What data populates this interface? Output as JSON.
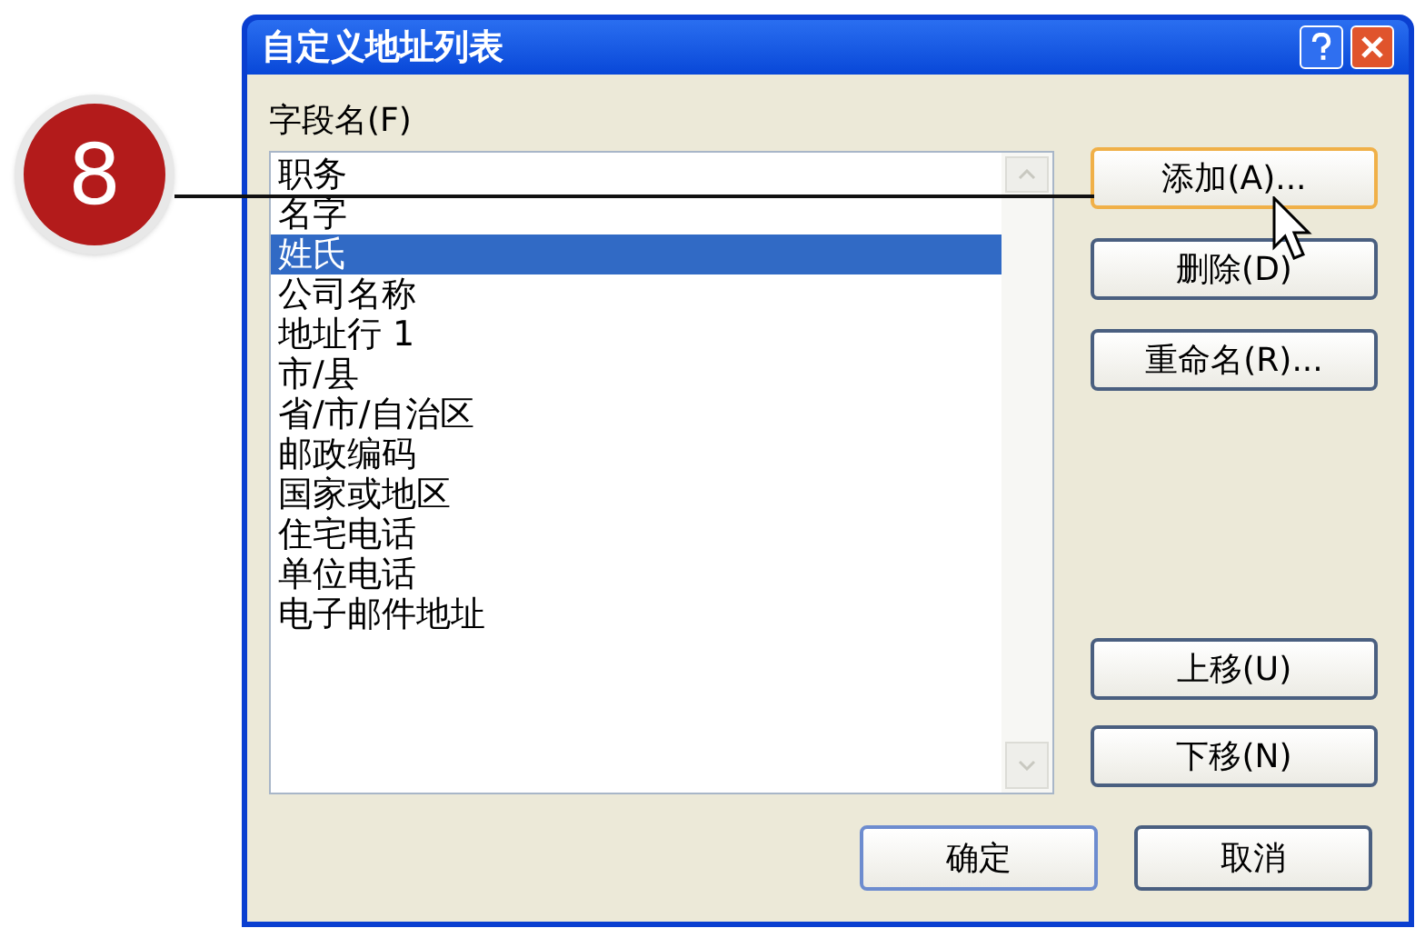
{
  "callout": {
    "number": "8"
  },
  "window": {
    "title": "自定义地址列表"
  },
  "field_list": {
    "label": "字段名(F)",
    "items": [
      {
        "label": "职务",
        "selected": false
      },
      {
        "label": "名字",
        "selected": false
      },
      {
        "label": "姓氏",
        "selected": true
      },
      {
        "label": "公司名称",
        "selected": false
      },
      {
        "label": "地址行 1",
        "selected": false
      },
      {
        "label": "市/县",
        "selected": false
      },
      {
        "label": "省/市/自治区",
        "selected": false
      },
      {
        "label": "邮政编码",
        "selected": false
      },
      {
        "label": "国家或地区",
        "selected": false
      },
      {
        "label": "住宅电话",
        "selected": false
      },
      {
        "label": "单位电话",
        "selected": false
      },
      {
        "label": "电子邮件地址",
        "selected": false
      }
    ]
  },
  "side_buttons": [
    {
      "label": "添加(A)...",
      "hovered": true
    },
    {
      "label": "删除(D)",
      "hovered": false
    },
    {
      "label": "重命名(R)...",
      "hovered": false
    }
  ],
  "move_buttons": [
    "上移(U)",
    "下移(N)"
  ],
  "buttons": [
    {
      "label": "确定",
      "default": true
    },
    {
      "label": "取消",
      "default": false
    }
  ]
}
